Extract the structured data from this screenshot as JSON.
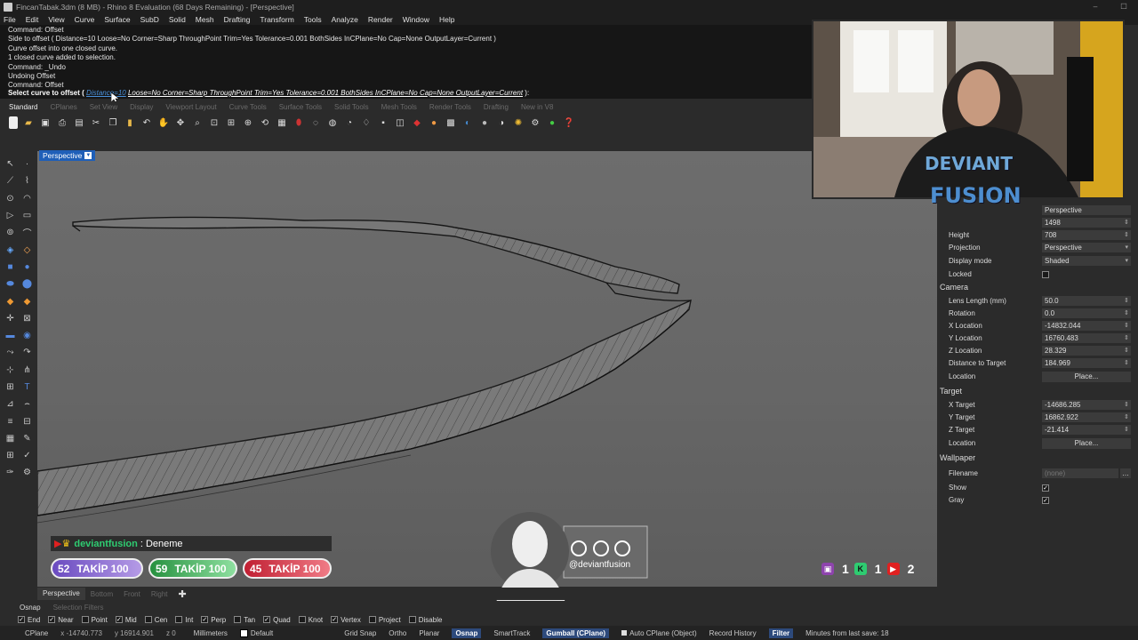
{
  "window": {
    "title": "FincanTabak.3dm (8 MB) - Rhino 8 Evaluation (68 Days Remaining) - [Perspective]"
  },
  "menu": [
    "File",
    "Edit",
    "View",
    "Curve",
    "Surface",
    "SubD",
    "Solid",
    "Mesh",
    "Drafting",
    "Transform",
    "Tools",
    "Analyze",
    "Render",
    "Window",
    "Help"
  ],
  "command_history": [
    "Command: Offset",
    "Side to offset ( Distance=10  Loose=No  Corner=Sharp  ThroughPoint  Trim=Yes  Tolerance=0.001  BothSides  InCPlane=No  Cap=None  OutputLayer=Current )",
    "Curve offset into one closed curve.",
    "1 closed curve added to selection.",
    "Command: _Undo",
    "Undoing Offset",
    "Command: Offset"
  ],
  "command_prompt": {
    "prefix": "Select curve to offset (",
    "highlight": "Distance=10",
    "options": "Loose=No  Corner=Sharp  ThroughPoint  Trim=Yes  Tolerance=0.001  BothSides  InCPlane=No  Cap=None  OutputLayer=Current",
    "suffix": "):"
  },
  "toolbar_tabs": [
    "Standard",
    "CPlanes",
    "Set View",
    "Display",
    "Viewport Layout",
    "Curve Tools",
    "Surface Tools",
    "Solid Tools",
    "Mesh Tools",
    "Render Tools",
    "Drafting",
    "New in V8"
  ],
  "viewport": {
    "name": "Perspective"
  },
  "viewport_tabs": [
    "Perspective",
    "Bottom",
    "Front",
    "Right"
  ],
  "properties": {
    "title_value": "Perspective",
    "width": "1498",
    "height_label": "Height",
    "height": "708",
    "projection_label": "Projection",
    "projection": "Perspective",
    "display_mode_label": "Display mode",
    "display_mode": "Shaded",
    "locked_label": "Locked",
    "camera_section": "Camera",
    "lens_label": "Lens Length (mm)",
    "lens": "50.0",
    "rotation_label": "Rotation",
    "rotation": "0.0",
    "xloc_label": "X Location",
    "xloc": "-14832.044",
    "yloc_label": "Y Location",
    "yloc": "16760.483",
    "zloc_label": "Z Location",
    "zloc": "28.329",
    "dist_label": "Distance to Target",
    "dist": "184.969",
    "location_label": "Location",
    "place_btn": "Place...",
    "target_section": "Target",
    "xtarget_label": "X Target",
    "xtarget": "-14686.285",
    "ytarget_label": "Y Target",
    "ytarget": "16862.922",
    "ztarget_label": "Z Target",
    "ztarget": "-21.414",
    "target_location_label": "Location",
    "wallpaper_section": "Wallpaper",
    "filename_label": "Filename",
    "filename": "(none)",
    "show_label": "Show",
    "gray_label": "Gray"
  },
  "osnap_tabs": [
    "Osnap",
    "Selection Filters"
  ],
  "osnaps": [
    {
      "label": "End",
      "checked": true
    },
    {
      "label": "Near",
      "checked": true
    },
    {
      "label": "Point",
      "checked": false
    },
    {
      "label": "Mid",
      "checked": true
    },
    {
      "label": "Cen",
      "checked": false
    },
    {
      "label": "Int",
      "checked": false
    },
    {
      "label": "Perp",
      "checked": true
    },
    {
      "label": "Tan",
      "checked": false
    },
    {
      "label": "Quad",
      "checked": true
    },
    {
      "label": "Knot",
      "checked": false
    },
    {
      "label": "Vertex",
      "checked": true
    },
    {
      "label": "Project",
      "checked": false
    },
    {
      "label": "Disable",
      "checked": false
    }
  ],
  "status": {
    "cplane": "CPlane",
    "x": "x -14740.773",
    "y": "y 16914.901",
    "z": "z 0",
    "units": "Millimeters",
    "layer": "Default",
    "grid_snap": "Grid Snap",
    "ortho": "Ortho",
    "planar": "Planar",
    "osnap": "Osnap",
    "smarttrack": "SmartTrack",
    "gumball": "Gumball (CPlane)",
    "auto_cplane": "Auto CPlane (Object)",
    "record_history": "Record History",
    "filter": "Filter",
    "minutes": "Minutes from last save: 18"
  },
  "overlay": {
    "chat_user": "deviantfusion",
    "chat_msg": ": Deneme",
    "pills": [
      {
        "num": "52",
        "label": "TAKİP 100",
        "color": "#7b5cc9"
      },
      {
        "num": "59",
        "label": "TAKİP 100",
        "color": "#2fa84a"
      },
      {
        "num": "45",
        "label": "TAKİP 100",
        "color": "#d0283a"
      }
    ],
    "handle": "@deviantfusion",
    "brand_line1": "DEVIANT",
    "brand_line2": "FUSION",
    "platforms": [
      {
        "icon": "twitch-icon",
        "count": "1",
        "color": "#8e44ad"
      },
      {
        "icon": "kick-icon",
        "count": "1",
        "color": "#2ecc71"
      },
      {
        "icon": "youtube-icon",
        "count": "2",
        "color": "#e02020"
      }
    ]
  }
}
